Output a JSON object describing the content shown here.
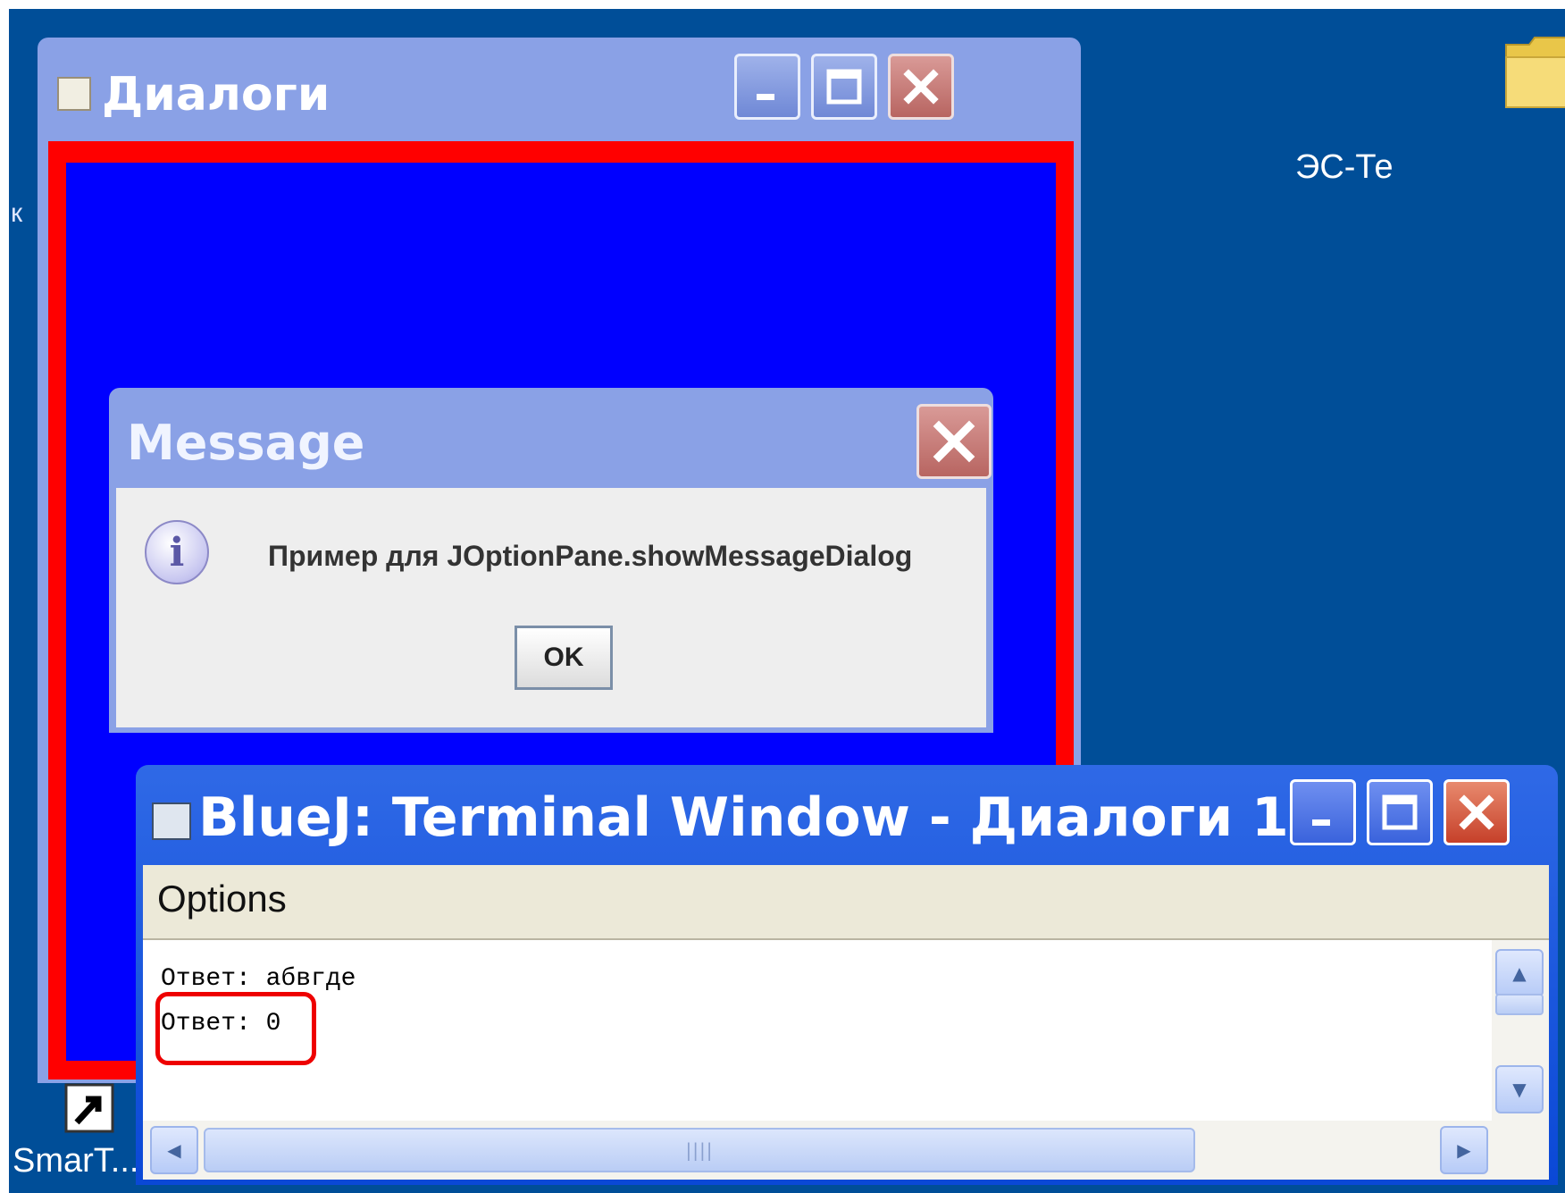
{
  "desktop": {
    "folder_label": "ЭС-Те",
    "left_edge_label": "к",
    "shortcut_label": "SmarT..."
  },
  "dialogs_window": {
    "title": "Диалоги",
    "buttons": {
      "minimize": "_",
      "maximize": "□",
      "close": "✕"
    }
  },
  "message_dialog": {
    "title": "Message",
    "icon_glyph": "i",
    "text": "Пример для JOptionPane.showMessageDialog",
    "ok_label": "OK",
    "close": "✕"
  },
  "terminal_window": {
    "title": "BlueJ:  Terminal Window - Диалоги 1",
    "buttons": {
      "minimize": "_",
      "maximize": "□",
      "close": "✕"
    },
    "menu": {
      "options": "Options"
    },
    "lines": [
      "Ответ: абвгде",
      "Ответ: 0"
    ],
    "scrollbar": {
      "up": "▲",
      "down": "▼",
      "left": "◀",
      "right": "▶",
      "grip": "||||"
    }
  },
  "colors": {
    "desktop_bg": "#004e98",
    "frame_red": "#ff0000",
    "content_blue": "#0000ff",
    "highlight": "#ee0000"
  }
}
